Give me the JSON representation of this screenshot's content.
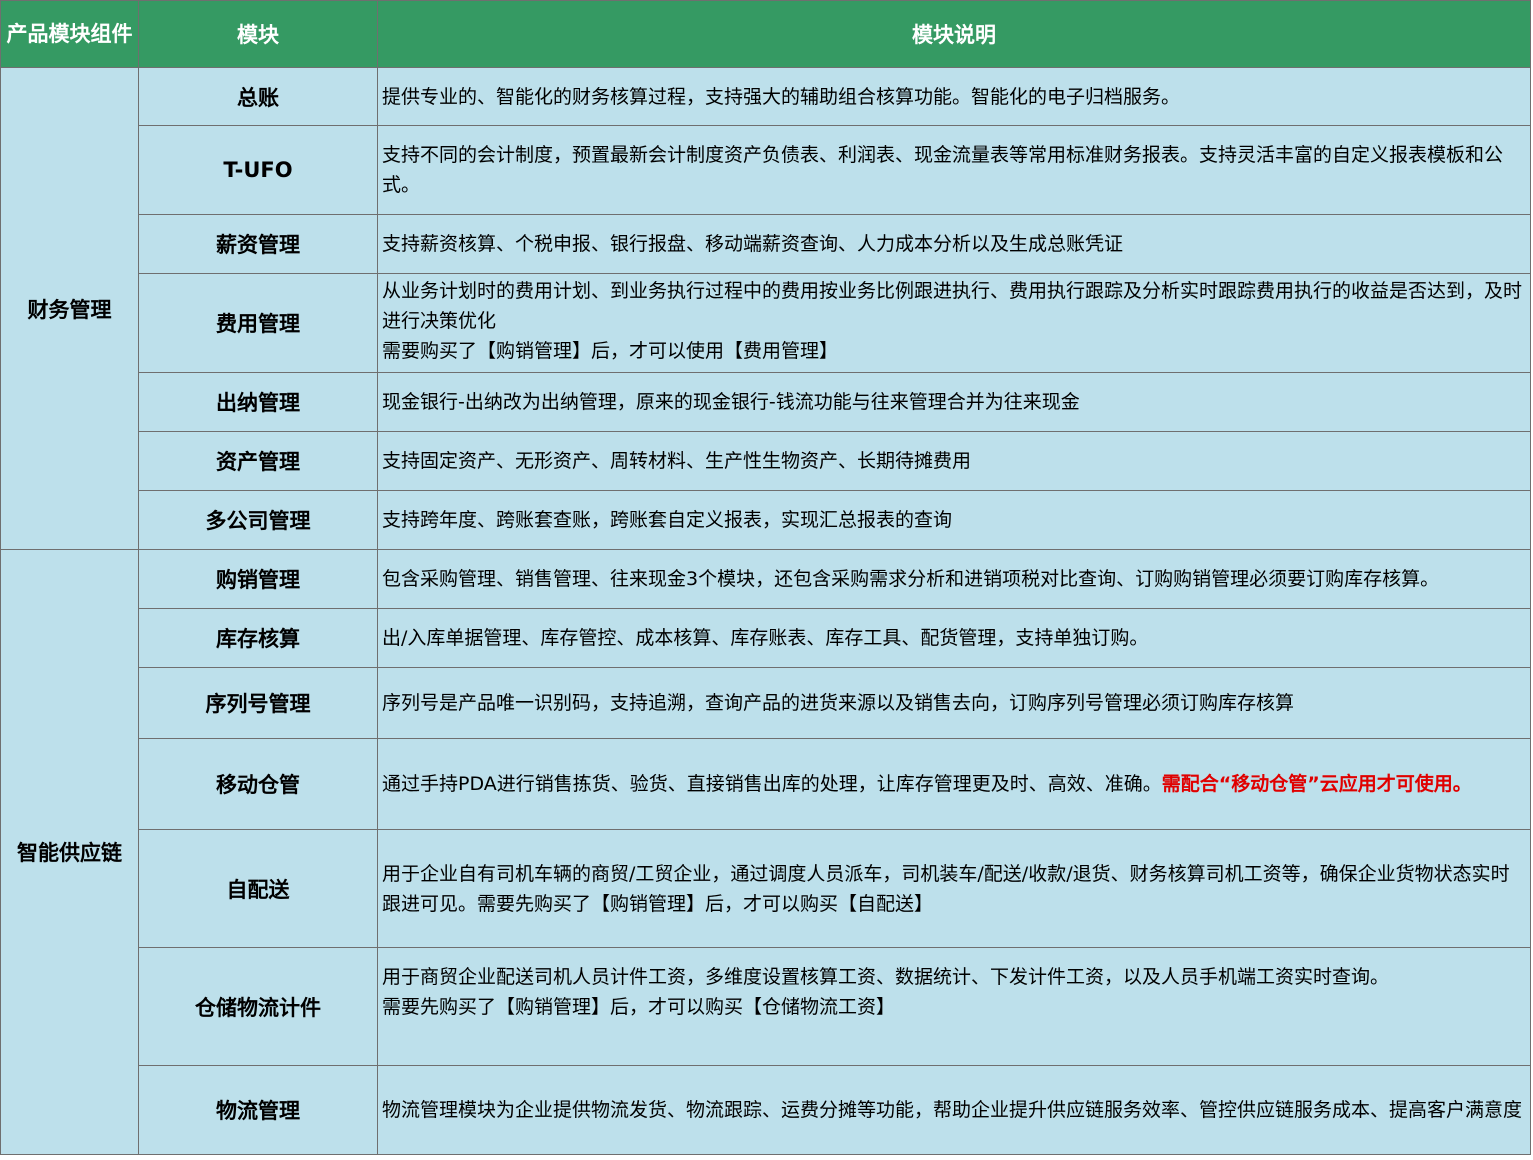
{
  "headers": {
    "group": "产品模块组件",
    "module": "模块",
    "description": "模块说明"
  },
  "groups": [
    {
      "name": "财务管理",
      "rows": [
        {
          "module": "总账",
          "lines": [
            "提供专业的、智能化的财务核算过程，支持强大的辅助组合核算功能。智能化的电子归档服务。"
          ]
        },
        {
          "module": "T-UFO",
          "lines": [
            "支持不同的会计制度，预置最新会计制度资产负债表、利润表、现金流量表等常用标准财务报表。支持灵活丰富的自定义报表模板和公式。"
          ]
        },
        {
          "module": "薪资管理",
          "lines": [
            "支持薪资核算、个税申报、银行报盘、移动端薪资查询、人力成本分析以及生成总账凭证"
          ]
        },
        {
          "module": "费用管理",
          "lines": [
            "从业务计划时的费用计划、到业务执行过程中的费用按业务比例跟进执行、费用执行跟踪及分析实时跟踪费用执行的收益是否达到，及时进行决策优化",
            "需要购买了【购销管理】后，才可以使用【费用管理】"
          ]
        },
        {
          "module": "出纳管理",
          "lines": [
            "现金银行-出纳改为出纳管理，原来的现金银行-钱流功能与往来管理合并为往来现金"
          ]
        },
        {
          "module": "资产管理",
          "lines": [
            "支持固定资产、无形资产、周转材料、生产性生物资产、长期待摊费用"
          ]
        },
        {
          "module": "多公司管理",
          "lines": [
            "支持跨年度、跨账套查账，跨账套自定义报表，实现汇总报表的查询"
          ]
        }
      ]
    },
    {
      "name": "智能供应链",
      "rows": [
        {
          "module": "购销管理",
          "lines": [
            "包含采购管理、销售管理、往来现金3个模块，还包含采购需求分析和进销项税对比查询、订购购销管理必须要订购库存核算。"
          ]
        },
        {
          "module": "库存核算",
          "lines": [
            "出/入库单据管理、库存管控、成本核算、库存账表、库存工具、配货管理，支持单独订购。"
          ]
        },
        {
          "module": "序列号管理",
          "lines": [
            "序列号是产品唯一识别码，支持追溯，查询产品的进货来源以及销售去向，订购序列号管理必须订购库存核算"
          ]
        },
        {
          "module": "移动仓管",
          "text": "通过手持PDA进行销售拣货、验货、直接销售出库的处理，让库存管理更及时、高效、准确。",
          "highlight": "需配合“移动仓管”云应用才可使用。",
          "highlight_color": "#e00000"
        },
        {
          "module": "自配送",
          "lines": [
            "用于企业自有司机车辆的商贸/工贸企业，通过调度人员派车，司机装车/配送/收款/退货、财务核算司机工资等，确保企业货物状态实时跟进可见。需要先购买了【购销管理】后，才可以购买【自配送】"
          ]
        },
        {
          "module": "仓储物流计件",
          "lines": [
            "用于商贸企业配送司机人员计件工资，多维度设置核算工资、数据统计、下发计件工资，以及人员手机端工资实时查询。",
            "需要先购买了【购销管理】后，才可以购买【仓储物流工资】"
          ]
        },
        {
          "module": "物流管理",
          "lines": [
            "物流管理模块为企业提供物流发货、物流跟踪、运费分摊等功能，帮助企业提升供应链服务效率、管控供应链服务成本、提高客户满意度"
          ]
        }
      ]
    }
  ]
}
